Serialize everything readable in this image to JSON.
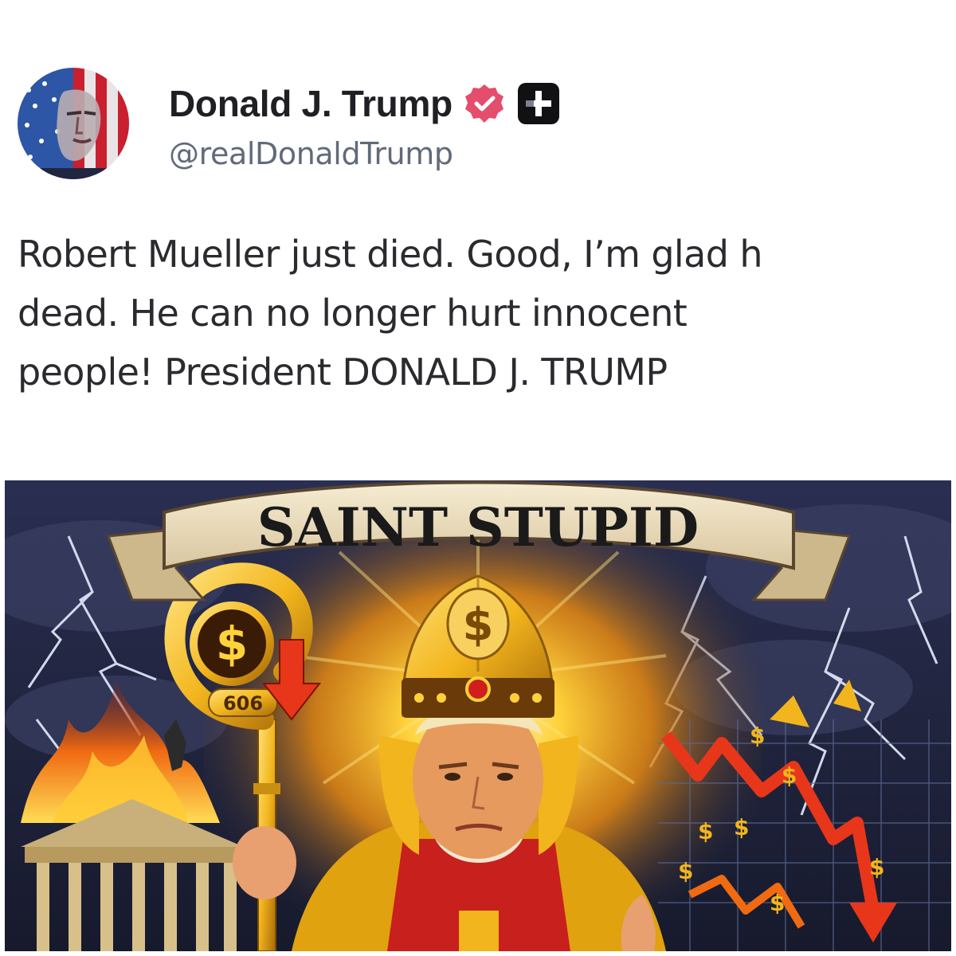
{
  "post": {
    "author": {
      "display_name": "Donald J. Trump",
      "handle": "@realDonaldTrump",
      "avatar_icon": "avatar-flag-portrait",
      "verified_icon": "verified-badge-icon",
      "verified_color": "#e44d6b",
      "plus_icon": "plus-square-icon"
    },
    "text_lines": [
      "Robert Mueller just died. Good, I’m glad h",
      "dead. He can no longer hurt innocent",
      "people! President DONALD J. TRUMP"
    ]
  },
  "image": {
    "banner_text": "SAINT STUPID",
    "hat_symbol": "$",
    "staff_symbol": "$",
    "staff_number": "606",
    "chart_symbols": [
      "$",
      "$",
      "$",
      "$",
      "$",
      "$",
      "$"
    ],
    "colors": {
      "sky": "#1f2440",
      "gold": "#f2b51d",
      "fire": "#f06a12",
      "crash_arrow": "#e8361a"
    }
  }
}
